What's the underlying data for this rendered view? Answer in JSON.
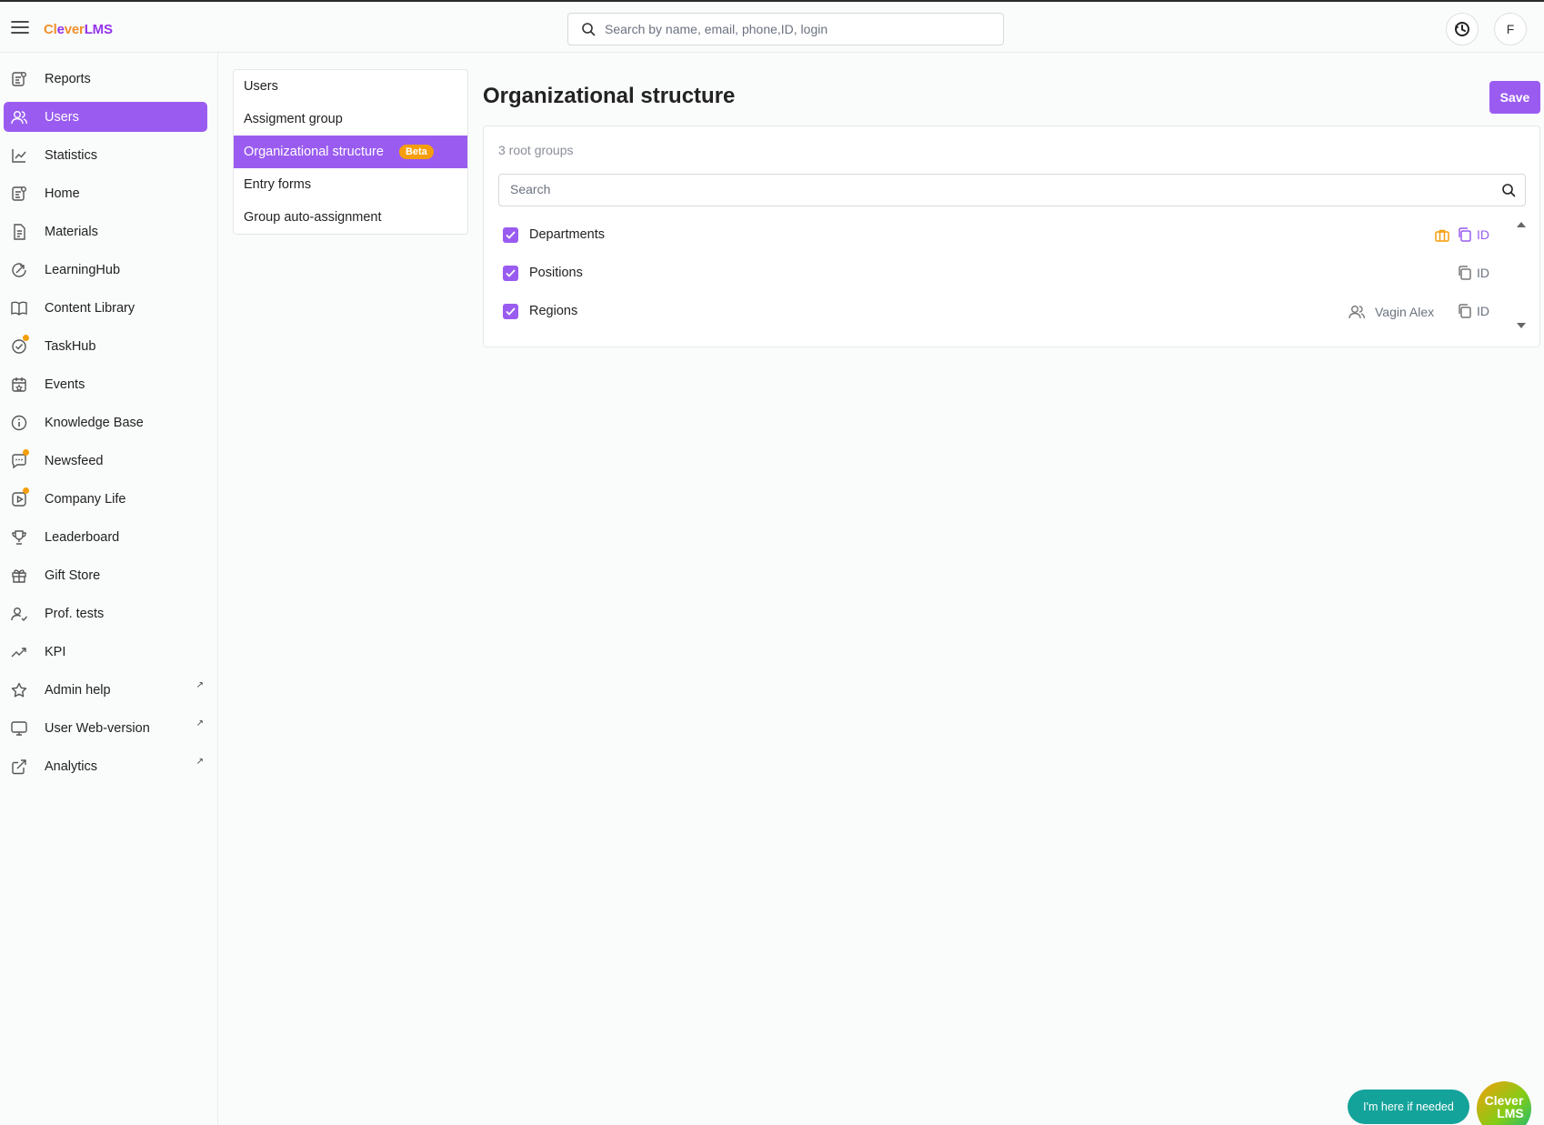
{
  "app": {
    "logo_prefix": "Cl",
    "logo_mid": "e",
    "logo_rest": "ver",
    "logo_suffix": "LMS",
    "brand_color": "#9a5cf0",
    "accent_orange": "#f59e0b"
  },
  "topbar": {
    "search_placeholder": "Search by name, email, phone,ID, login",
    "avatar_initial": "F"
  },
  "sidebar": {
    "items": [
      {
        "label": "Reports",
        "icon": "reports-icon"
      },
      {
        "label": "Users",
        "icon": "users-icon",
        "active": true
      },
      {
        "label": "Statistics",
        "icon": "statistics-icon"
      },
      {
        "label": "Home",
        "icon": "home-icon"
      },
      {
        "label": "Materials",
        "icon": "materials-icon"
      },
      {
        "label": "LearningHub",
        "icon": "learninghub-icon"
      },
      {
        "label": "Content Library",
        "icon": "book-icon"
      },
      {
        "label": "TaskHub",
        "icon": "taskhub-icon",
        "dot": true
      },
      {
        "label": "Events",
        "icon": "calendar-icon"
      },
      {
        "label": "Knowledge Base",
        "icon": "info-icon"
      },
      {
        "label": "Newsfeed",
        "icon": "newsfeed-icon",
        "dot": true
      },
      {
        "label": "Company Life",
        "icon": "video-icon",
        "dot": true
      },
      {
        "label": "Leaderboard",
        "icon": "trophy-icon"
      },
      {
        "label": "Gift Store",
        "icon": "gift-icon"
      },
      {
        "label": "Prof. tests",
        "icon": "user-check-icon"
      },
      {
        "label": "KPI",
        "icon": "trend-icon"
      },
      {
        "label": "Admin help",
        "icon": "star-icon",
        "external": true
      },
      {
        "label": "User Web-version",
        "icon": "monitor-icon",
        "external": true
      },
      {
        "label": "Analytics",
        "icon": "external-link-icon",
        "external": true
      }
    ],
    "external_glyph": "↗"
  },
  "subnav": {
    "items": [
      {
        "label": "Users"
      },
      {
        "label": "Assigment group"
      },
      {
        "label": "Organizational structure",
        "active": true,
        "badge": "Beta"
      },
      {
        "label": "Entry forms"
      },
      {
        "label": "Group auto-assignment"
      }
    ]
  },
  "main": {
    "title": "Organizational structure",
    "save_label": "Save",
    "root_count": "3 root groups",
    "search_placeholder": "Search",
    "groups": [
      {
        "name": "Departments",
        "checked": true,
        "id_label": "ID",
        "has_briefcase": true
      },
      {
        "name": "Positions",
        "checked": true,
        "id_label": "ID"
      },
      {
        "name": "Regions",
        "checked": true,
        "id_label": "ID",
        "manager": "Vagin Alex"
      }
    ]
  },
  "chat": {
    "pill_label": "I'm here if needed",
    "logo_line1": "Clever",
    "logo_line2": "LMS"
  }
}
